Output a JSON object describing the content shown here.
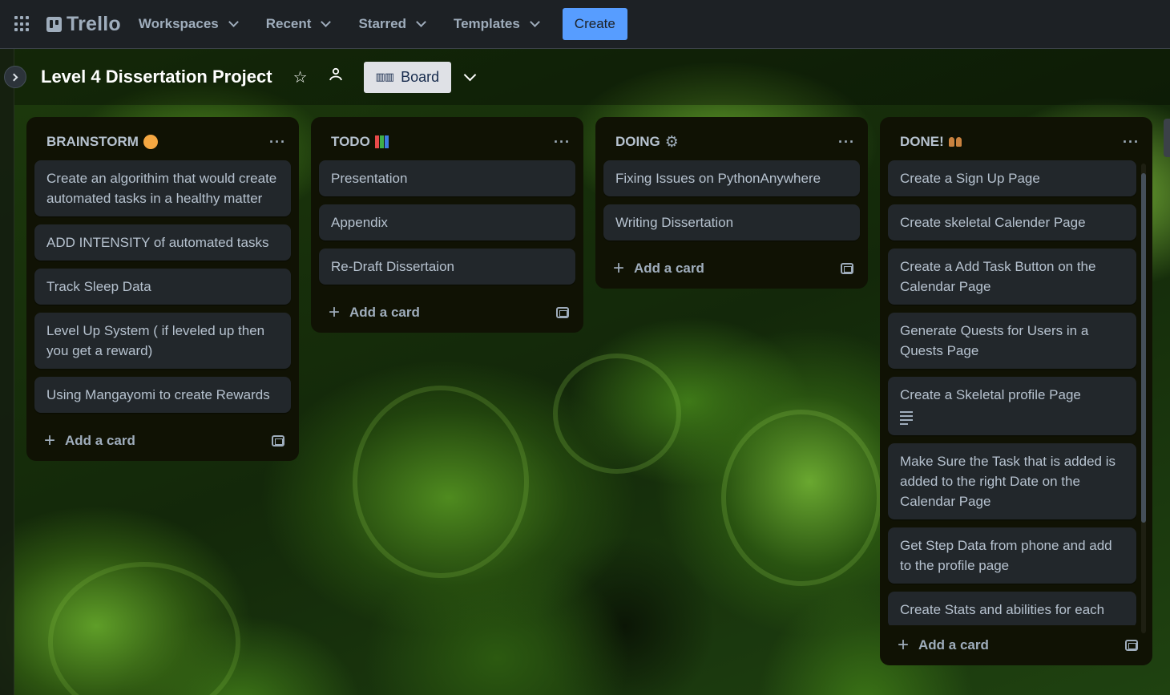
{
  "topbar": {
    "logo": "Trello",
    "nav": [
      "Workspaces",
      "Recent",
      "Starred",
      "Templates"
    ],
    "create_label": "Create"
  },
  "board": {
    "title": "Level 4 Dissertation Project",
    "view_label": "Board"
  },
  "lists": [
    {
      "title": "BRAINSTORM",
      "emoji_color": "#f4a742",
      "cards": [
        "Create an algorithim that would create automated tasks in a healthy matter",
        "ADD INTENSITY of automated tasks",
        "Track Sleep Data",
        "Level Up System ( if leveled up then you get a reward)",
        "Using Mangayomi to create Rewards"
      ],
      "add_label": "Add a card"
    },
    {
      "title": "TODO",
      "emoji_color": "#e84a4a",
      "cards": [
        "Presentation",
        "Appendix",
        "Re-Draft Dissertaion"
      ],
      "add_label": "Add a card"
    },
    {
      "title": "DOING",
      "emoji_color": "#9fadbc",
      "cards": [
        "Fixing Issues on PythonAnywhere",
        "Writing Dissertation"
      ],
      "add_label": "Add a card"
    },
    {
      "title": "DONE!",
      "emoji_color": "#c9823f",
      "cards": [
        "Create a Sign Up Page",
        "Create skeletal Calender Page",
        "Create a Add Task Button on the Calendar Page",
        "Generate Quests for Users in a Quests Page",
        "Create a Skeletal profile Page",
        "Make Sure the Task that is added is added to the right Date on the Calendar Page",
        "Get Step Data from phone and add to the profile page",
        "Create Stats and abilities for each"
      ],
      "add_label": "Add a card"
    }
  ]
}
